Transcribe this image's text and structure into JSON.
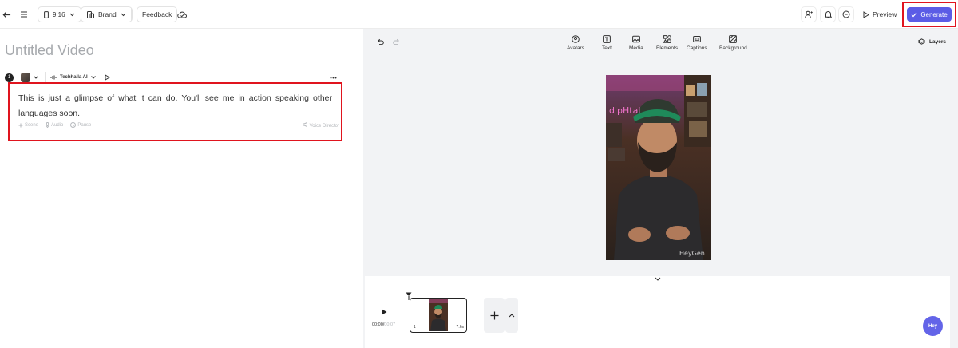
{
  "header": {
    "aspect_ratio": "9:16",
    "brand_label": "Brand",
    "feedback_label": "Feedback",
    "preview_label": "Preview",
    "generate_label": "Generate"
  },
  "editor": {
    "video_title_placeholder": "Untitled Video",
    "scene": {
      "number": "1",
      "voice_name": "Techhalla AI",
      "script": "This is just a glimpse of what it can do. You'll see me in action speaking other languages soon.",
      "tools": {
        "scene": "Scene",
        "audio": "Audio",
        "pause": "Pause",
        "voice_director": "Voice Director"
      }
    }
  },
  "canvas_toolbar": {
    "avatars": "Avatars",
    "text": "Text",
    "media": "Media",
    "elements": "Elements",
    "captions": "Captions",
    "background": "Background",
    "layers": "Layers"
  },
  "preview": {
    "watermark": "HeyGen",
    "neon_sign": "dlpHtal"
  },
  "timeline": {
    "current_time": "00:00",
    "total_time": "00:07",
    "clip_index": "1",
    "clip_duration": "7.6s"
  },
  "assistant": {
    "label": "Hey"
  },
  "colors": {
    "accent": "#5b5ce6",
    "highlight": "#e0141e"
  }
}
